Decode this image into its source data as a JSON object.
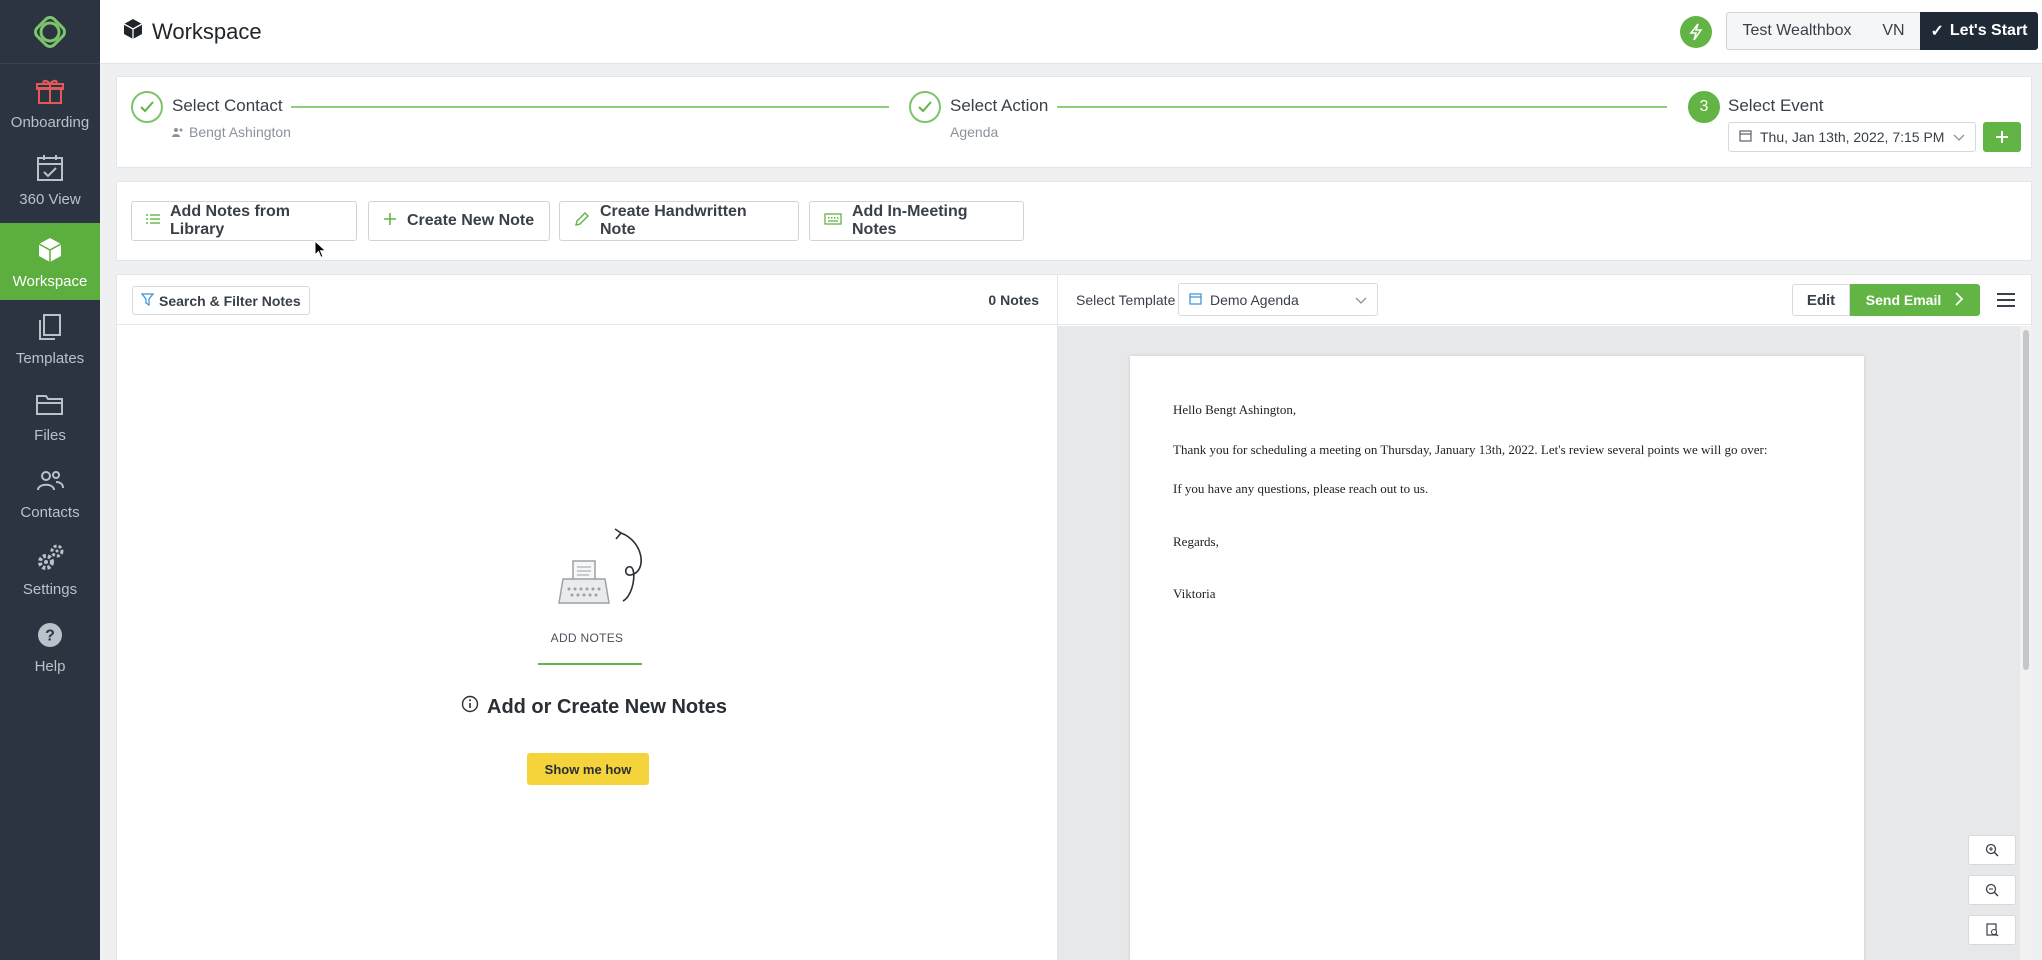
{
  "sidebar": {
    "items": [
      {
        "label": "Onboarding",
        "icon": "gift-icon"
      },
      {
        "label": "360 View",
        "icon": "calendar-icon"
      },
      {
        "label": "Workspace",
        "icon": "cube-icon",
        "active": true
      },
      {
        "label": "Templates",
        "icon": "copy-icon"
      },
      {
        "label": "Files",
        "icon": "folder-icon"
      },
      {
        "label": "Contacts",
        "icon": "people-icon"
      },
      {
        "label": "Settings",
        "icon": "gears-icon"
      },
      {
        "label": "Help",
        "icon": "help-icon"
      }
    ]
  },
  "topbar": {
    "title": "Workspace",
    "crm_label": "Test Wealthbox",
    "user_initials": "VN",
    "start_label": "Let's Start"
  },
  "stepper": {
    "steps": [
      {
        "title": "Select Contact",
        "sub": "Bengt Ashington",
        "state": "done"
      },
      {
        "title": "Select Action",
        "sub": "Agenda",
        "state": "done"
      },
      {
        "title": "Select Event",
        "number": "3",
        "state": "current"
      }
    ],
    "event_value": "Thu, Jan 13th, 2022, 7:15 PM"
  },
  "actions": {
    "library": "Add Notes from Library",
    "create": "Create New Note",
    "handwritten": "Create Handwritten Note",
    "in_meeting": "Add In-Meeting Notes"
  },
  "notes": {
    "filter_label": "Search & Filter Notes",
    "count": "0 Notes",
    "empty_label": "ADD NOTES",
    "empty_title": "Add or Create New Notes",
    "show_me": "Show me how"
  },
  "preview": {
    "template_label": "Select Template",
    "template_value": "Demo Agenda",
    "edit_label": "Edit",
    "send_label": "Send Email",
    "letter": {
      "greeting": "Hello Bengt Ashington,",
      "line1": "Thank you for scheduling a meeting on Thursday, January 13th, 2022.  Let's review several points we will go over:",
      "line2": "If you have any questions, please reach out to us.",
      "closing": "Regards,",
      "signature": "Viktoria"
    }
  },
  "colors": {
    "accent_green": "#62b444",
    "sidebar_bg": "#2b3440",
    "start_button_bg": "#1f2a36",
    "highlight_yellow": "#f5d33a"
  }
}
